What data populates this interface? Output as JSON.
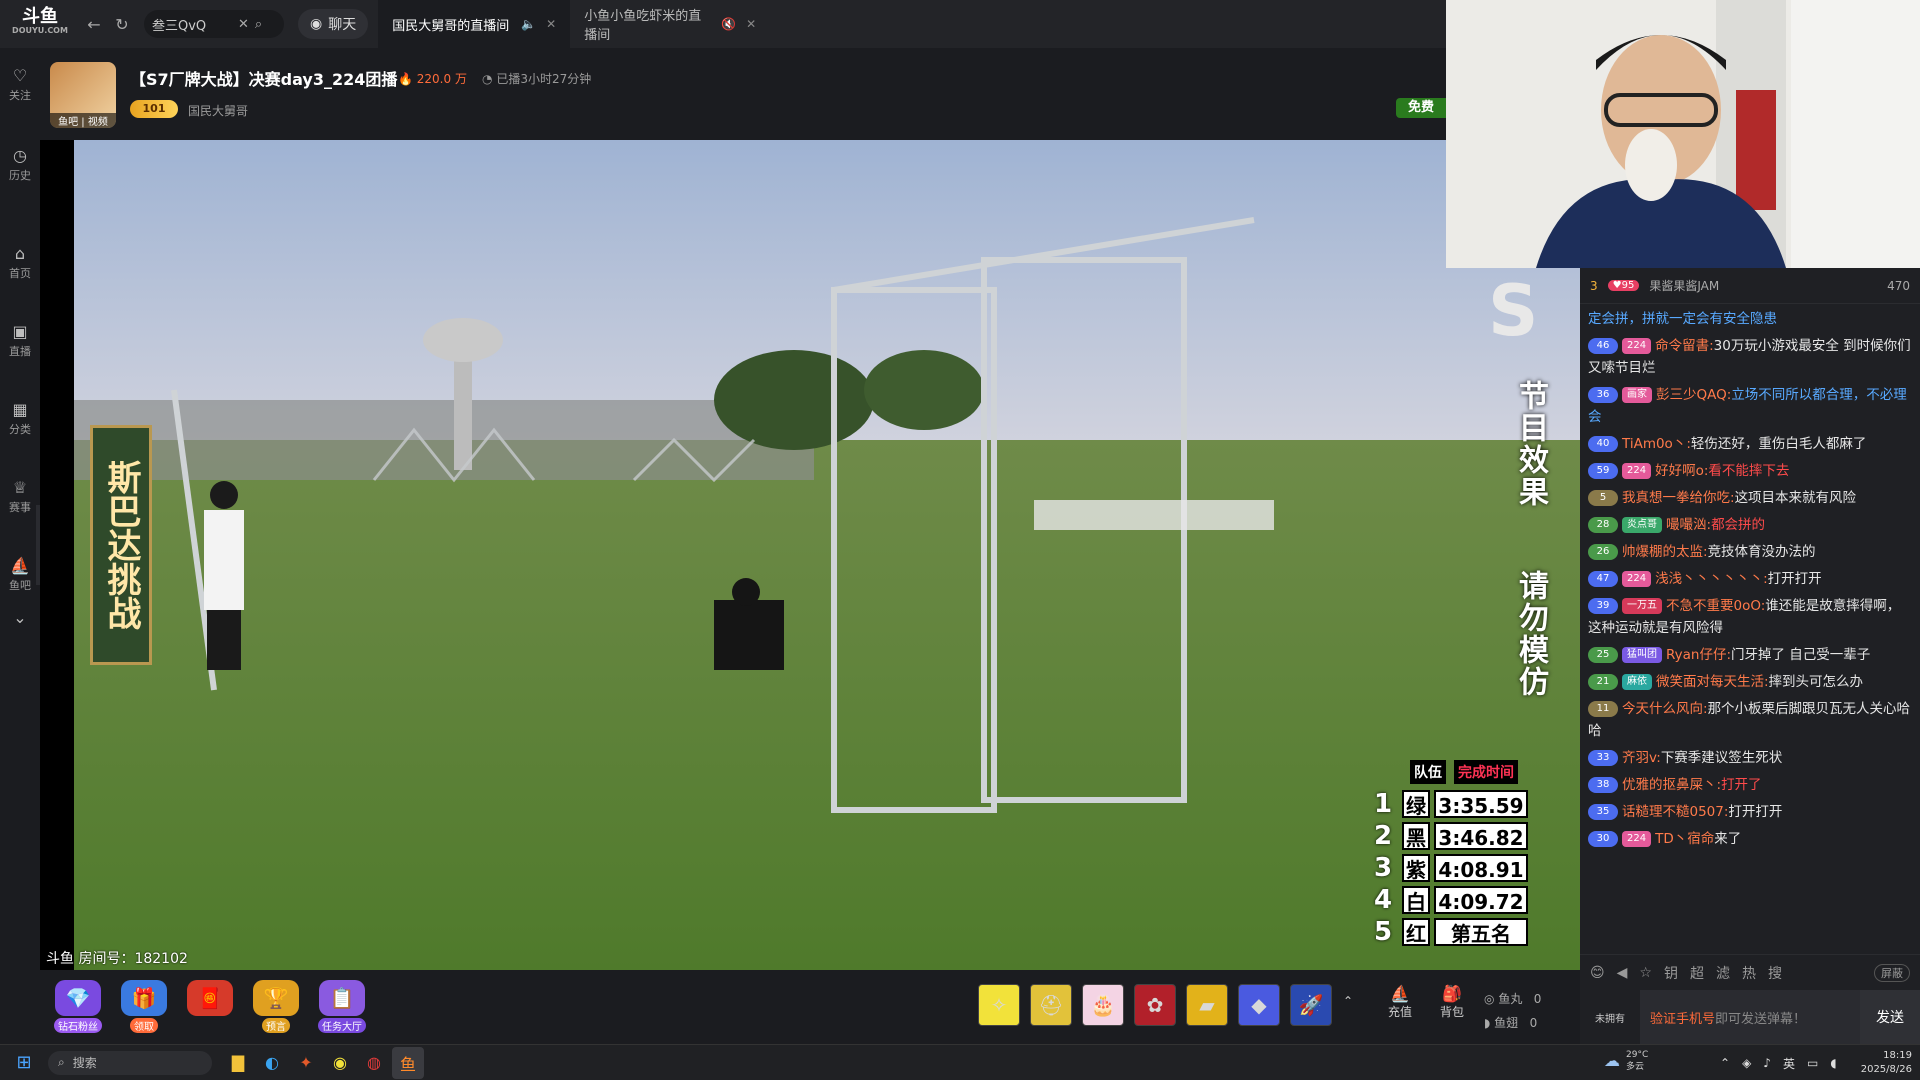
{
  "topbar": {
    "logo_text": "斗鱼",
    "logo_sub": "DOUYU.COM",
    "search_value": "叁三QvQ",
    "chat_label": "聊天",
    "tabs": [
      {
        "label": "国民大舅哥的直播间"
      },
      {
        "label": "小鱼小鱼吃虾米的直播间"
      }
    ]
  },
  "sidebar": {
    "items": [
      {
        "label": "关注",
        "icon": "heart-icon"
      },
      {
        "label": "历史",
        "icon": "clock-icon"
      },
      {
        "label": "首页",
        "icon": "home-icon"
      },
      {
        "label": "直播",
        "icon": "tv-icon"
      },
      {
        "label": "分类",
        "icon": "grid-icon"
      },
      {
        "label": "赛事",
        "icon": "trophy-icon"
      },
      {
        "label": "鱼吧",
        "icon": "fishbar-icon"
      }
    ]
  },
  "stream": {
    "avatar_tag": "鱼吧 | 视频",
    "title": "【S7厂牌大战】决赛day3_224团播",
    "heat": "220.0 万",
    "live_duration": "已播3小时27分钟",
    "level_badge": "101",
    "host_name": "国民大舅哥",
    "free_label": "免费",
    "room_id": "斗鱼 房间号：182102"
  },
  "video": {
    "sign_left": "斯巴达挑战",
    "overlay_right_1": "节目效果",
    "overlay_right_2": "请勿模仿",
    "big_letter": "S",
    "board": {
      "head_team": "队伍",
      "head_time": "完成时间",
      "rows": [
        {
          "rank": "1",
          "team": "绿",
          "time": "3:35.59"
        },
        {
          "rank": "2",
          "team": "黑",
          "time": "3:46.82"
        },
        {
          "rank": "3",
          "team": "紫",
          "time": "4:08.91"
        },
        {
          "rank": "4",
          "team": "白",
          "time": "4:09.72"
        },
        {
          "rank": "5",
          "team": "红",
          "time": "第五名"
        }
      ]
    }
  },
  "chat": {
    "rank": "3",
    "top_level": "95",
    "top_user": "果酱果酱JAM",
    "viewer_count": "470",
    "messages": [
      {
        "level": "",
        "fan": "",
        "user": "",
        "text": "定会拼，拼就一定会有安全隐患",
        "user_color": "blue",
        "text_style": "cont"
      },
      {
        "level": "46",
        "fan": "224",
        "user": "命令留書:",
        "text": "30万玩小游戏最安全 到时候你们又嗦节目烂",
        "user_color": "orange",
        "text_style": ""
      },
      {
        "level": "36",
        "fan": "画家",
        "user": "彭三少QAQ:",
        "text": "立场不同所以都合理，不必理会",
        "user_color": "orange",
        "text_style": "cont"
      },
      {
        "level": "40",
        "fan": "",
        "user": "TiAm0o丶:",
        "text": "轻伤还好，重伤白毛人都麻了",
        "user_color": "orange",
        "text_style": ""
      },
      {
        "level": "59",
        "fan": "224",
        "user": "好好啊o:",
        "text": "看不能摔下去",
        "user_color": "orange",
        "text_style": "red"
      },
      {
        "level": "5",
        "fan": "",
        "user": "我真想一拳给你吃:",
        "text": "这项目本来就有风险",
        "user_color": "orange",
        "text_style": ""
      },
      {
        "level": "28",
        "fan": "炎点哥",
        "user": "嘬嘬汹:",
        "text": "都会拼的",
        "user_color": "orange",
        "text_style": "red"
      },
      {
        "level": "26",
        "fan": "",
        "user": "帅爆棚的太监:",
        "text": "竞技体育没办法的",
        "user_color": "orange",
        "text_style": ""
      },
      {
        "level": "47",
        "fan": "224",
        "user": "浅浅丶丶丶丶丶丶:",
        "text": "打开打开",
        "user_color": "orange",
        "text_style": ""
      },
      {
        "level": "39",
        "fan": "一万五",
        "user": "不急不重要0oO:",
        "text": "谁还能是故意摔得啊，这种运动就是有风险得",
        "user_color": "orange",
        "text_style": ""
      },
      {
        "level": "25",
        "fan": "猛叫团",
        "user": "Ryan仔仔:",
        "text": "门牙掉了 自己受一辈子",
        "user_color": "orange",
        "text_style": ""
      },
      {
        "level": "21",
        "fan": "麻依",
        "user": "微笑面对每天生活:",
        "text": "摔到头可怎么办",
        "user_color": "orange",
        "text_style": ""
      },
      {
        "level": "11",
        "fan": "",
        "user": "今天什么风向:",
        "text": "那个小板栗后脚跟贝瓦无人关心哈哈",
        "user_color": "orange",
        "text_style": ""
      },
      {
        "level": "33",
        "fan": "",
        "user": "齐羽v:",
        "text": "下赛季建议签生死状",
        "user_color": "orange",
        "text_style": ""
      },
      {
        "level": "38",
        "fan": "",
        "user": "优雅的抠鼻屎丶:",
        "text": "打开了",
        "user_color": "orange",
        "text_style": "red"
      },
      {
        "level": "35",
        "fan": "",
        "user": "话糙理不糙0507:",
        "text": "打开打开",
        "user_color": "orange",
        "text_style": ""
      },
      {
        "level": "30",
        "fan": "224",
        "user": "TD丶宿命",
        "text": "来了",
        "user_color": "orange",
        "text_style": ""
      }
    ],
    "shield_label": "屏蔽",
    "tools": [
      "😊",
      "◀",
      "☆",
      "钥",
      "超",
      "滤",
      "热",
      "搜"
    ],
    "no_role": "未拥有",
    "input_highlight": "验证手机号",
    "input_rest": "即可发送弹幕！",
    "send_label": "发送"
  },
  "giftbar": {
    "left": [
      {
        "label": "钻石粉丝"
      },
      {
        "label": "领取"
      },
      {
        "label": ""
      },
      {
        "label": "预言"
      },
      {
        "label": "任务大厅"
      }
    ],
    "recharge_label": "充值",
    "backpack_label": "背包",
    "fishball_label": "鱼丸",
    "fishball_value": "0",
    "fishwing_label": "鱼翅",
    "fishwing_value": "0"
  },
  "taskbar": {
    "search_label": "搜索",
    "weather_temp": "29°C",
    "weather_desc": "多云",
    "ime": "英",
    "time": "18:19",
    "date": "2025/8/26"
  }
}
